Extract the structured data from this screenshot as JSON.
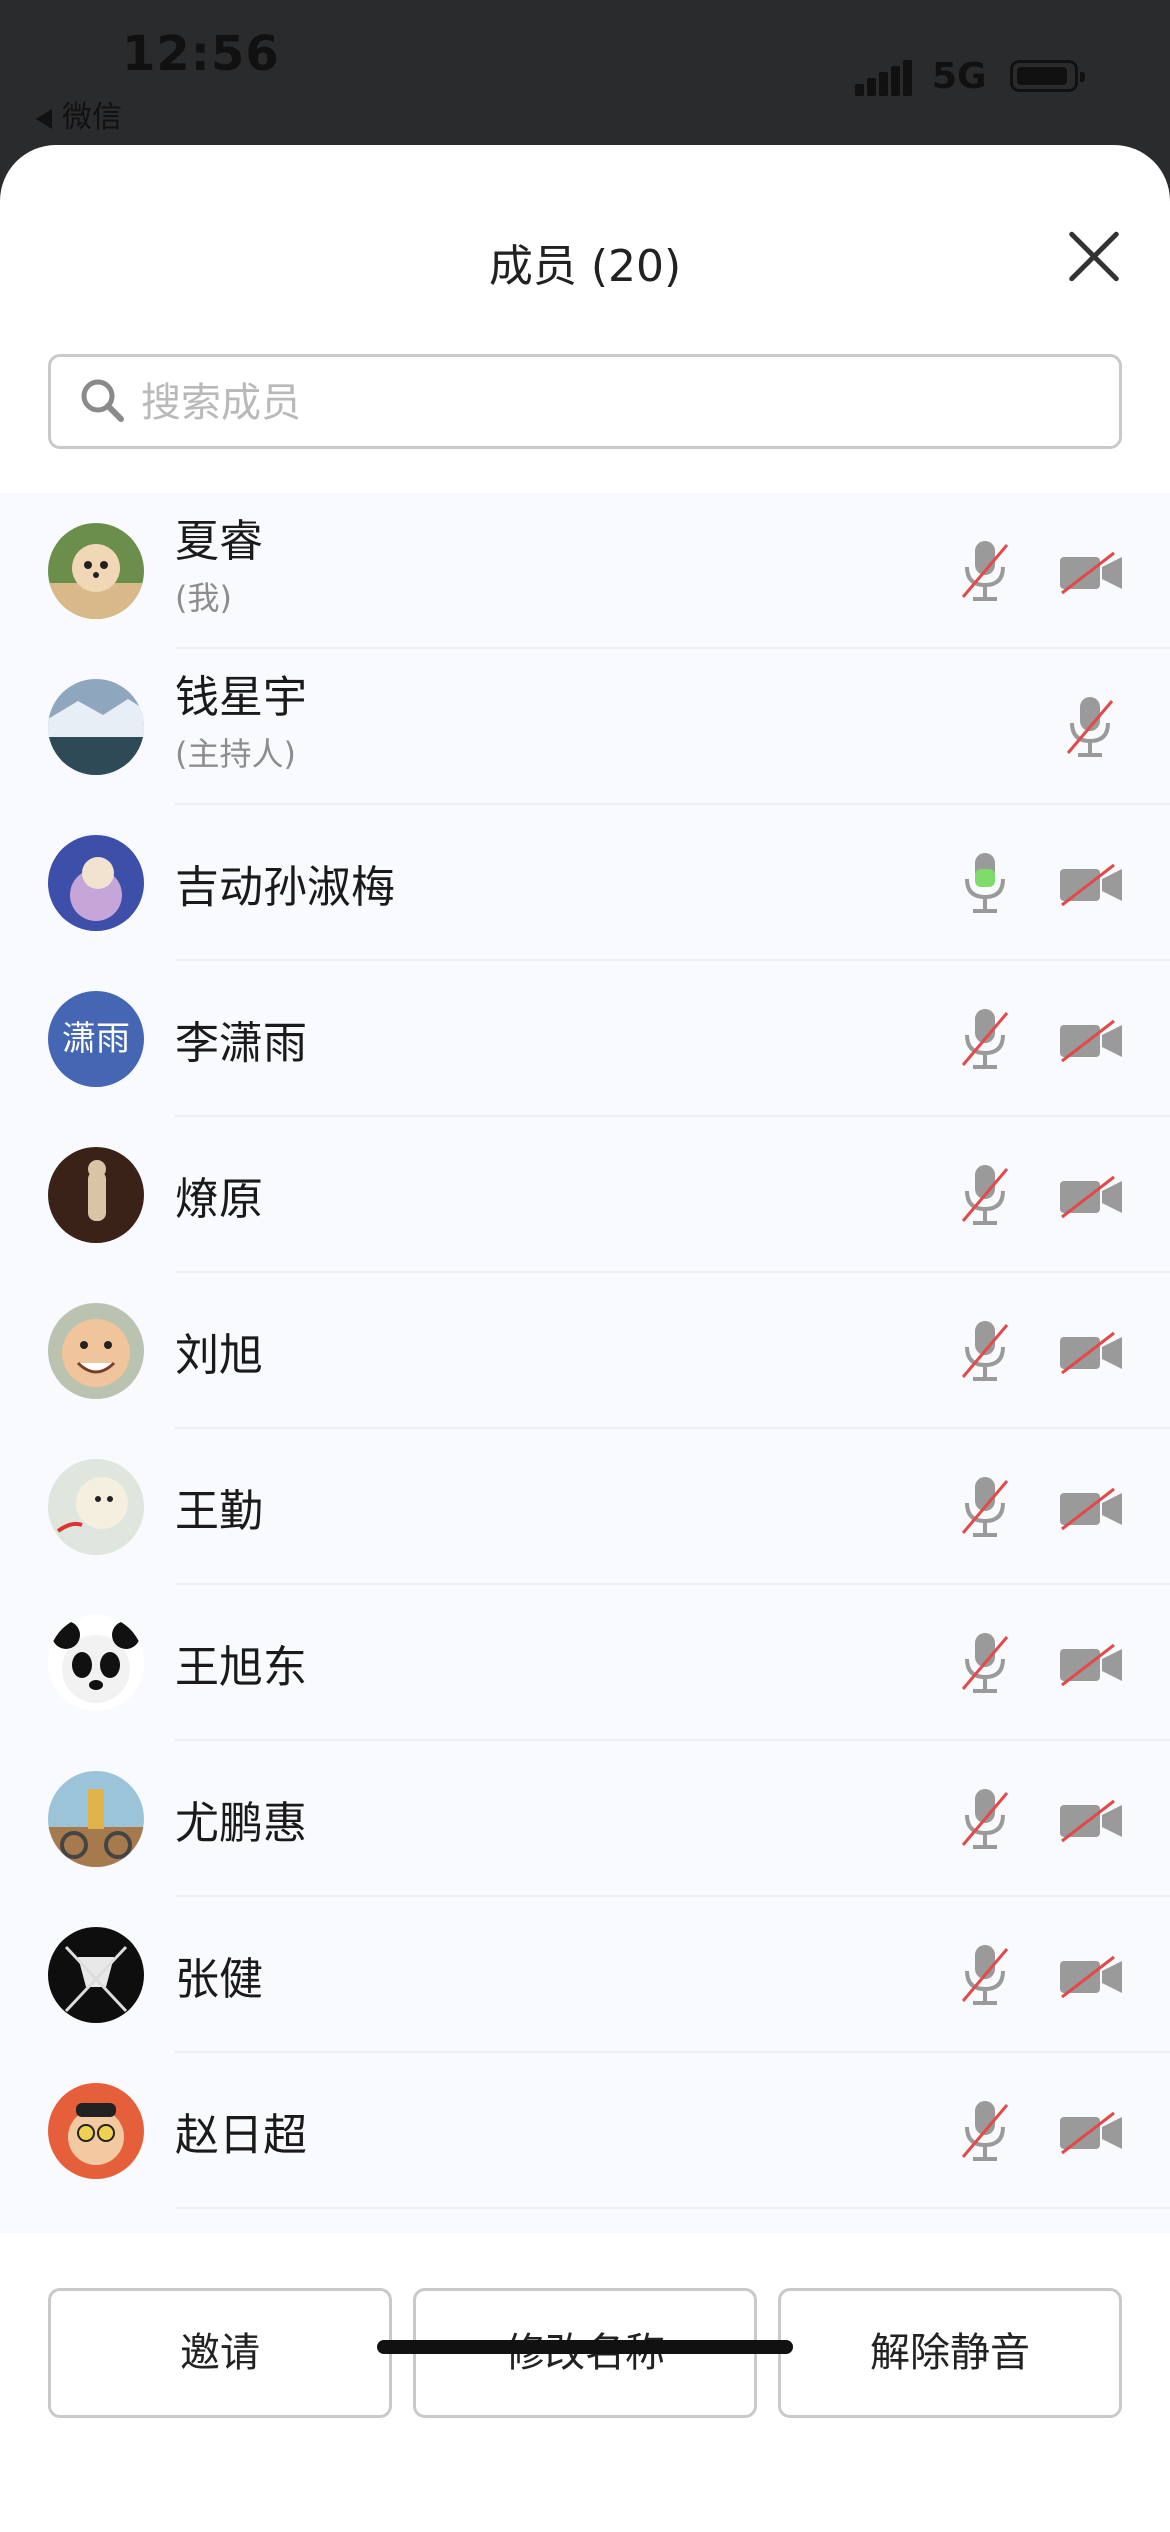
{
  "status_bar": {
    "time": "12:56",
    "back_app": "微信",
    "network": "5G"
  },
  "header": {
    "title": "成员 (20)"
  },
  "search": {
    "placeholder": "搜索成员"
  },
  "members": [
    {
      "name": "夏睿",
      "sub": "(我)",
      "mic": "muted",
      "camera": "off"
    },
    {
      "name": "钱星宇",
      "sub": "(主持人)",
      "mic": "muted",
      "camera": "none"
    },
    {
      "name": "吉动孙淑梅",
      "sub": "",
      "mic": "active",
      "camera": "off"
    },
    {
      "name": "李潇雨",
      "sub": "",
      "mic": "muted",
      "camera": "off",
      "avatar_text": "潇雨"
    },
    {
      "name": "燎原",
      "sub": "",
      "mic": "muted",
      "camera": "off"
    },
    {
      "name": "刘旭",
      "sub": "",
      "mic": "muted",
      "camera": "off"
    },
    {
      "name": "王勤",
      "sub": "",
      "mic": "muted",
      "camera": "off"
    },
    {
      "name": "王旭东",
      "sub": "",
      "mic": "muted",
      "camera": "off"
    },
    {
      "name": "尤鹏惠",
      "sub": "",
      "mic": "muted",
      "camera": "off"
    },
    {
      "name": "张健",
      "sub": "",
      "mic": "muted",
      "camera": "off"
    },
    {
      "name": "赵日超",
      "sub": "",
      "mic": "muted",
      "camera": "off"
    }
  ],
  "actions": {
    "invite": "邀请",
    "rename": "修改名称",
    "unmute": "解除静音"
  },
  "colors": {
    "muted_slash": "#e24a4a",
    "active_mic": "#7ddc6a",
    "icon_gray": "#9a9a9a",
    "avatar_text_bg": "#4466b3"
  }
}
